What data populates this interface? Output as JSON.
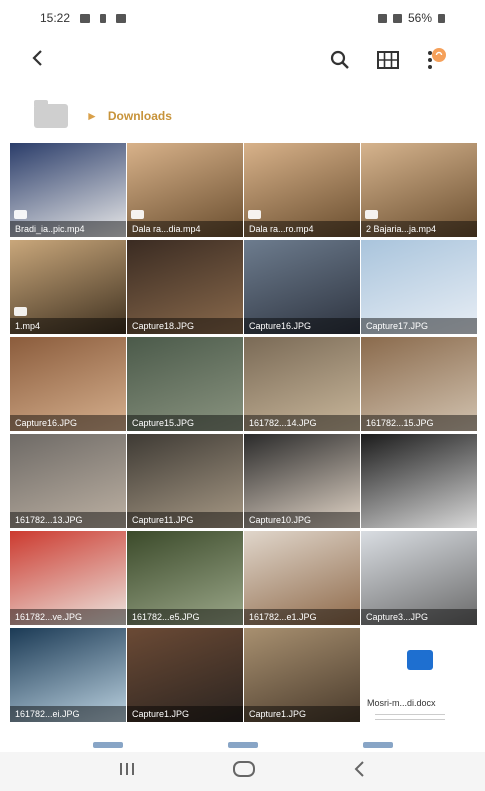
{
  "status": {
    "time": "15:22",
    "battery": "56%"
  },
  "appbar": {
    "back_icon": "back-arrow-icon",
    "search_icon": "search-icon",
    "grid_icon": "grid-view-icon",
    "menu_icon": "more-options-icon",
    "accent": "#f5a05a"
  },
  "path": {
    "label": "Downloads"
  },
  "tiles": [
    {
      "name": "Bradi_ia..pic.mp4",
      "colors": [
        "#2b3d6a",
        "#e9e9e9"
      ],
      "video": true
    },
    {
      "name": "Dala ra...dia.mp4",
      "colors": [
        "#d8b28a",
        "#6a4e2f"
      ],
      "video": true
    },
    {
      "name": "Dala ra...ro.mp4",
      "colors": [
        "#d8b28a",
        "#6a4e2f"
      ],
      "video": true
    },
    {
      "name": "2 Bajaria...ja.mp4",
      "colors": [
        "#d6b48e",
        "#6a4e2f"
      ],
      "video": true
    },
    {
      "name": "1.mp4",
      "colors": [
        "#c9a77b",
        "#3f3120"
      ],
      "video": true
    },
    {
      "name": "Capture18.JPG",
      "colors": [
        "#3a2b22",
        "#8a6a4c"
      ],
      "video": false
    },
    {
      "name": "Capture16.JPG",
      "colors": [
        "#6d7c8e",
        "#2e3440"
      ],
      "video": false
    },
    {
      "name": "Capture17.JPG",
      "colors": [
        "#a9c4dc",
        "#e8eef5"
      ],
      "video": false
    },
    {
      "name": "Capture16.JPG",
      "colors": [
        "#8b5c3c",
        "#d6b08e"
      ],
      "video": false
    },
    {
      "name": "Capture15.JPG",
      "colors": [
        "#4b5a4a",
        "#8a9480"
      ],
      "video": false
    },
    {
      "name": "161782...14.JPG",
      "colors": [
        "#7a6a56",
        "#c9b79b"
      ],
      "video": false
    },
    {
      "name": "161782...15.JPG",
      "colors": [
        "#8a6a4c",
        "#d2c3b0"
      ],
      "video": false
    },
    {
      "name": "161782...13.JPG",
      "colors": [
        "#6e6a66",
        "#bdb1a3"
      ],
      "video": false
    },
    {
      "name": "Capture11.JPG",
      "colors": [
        "#3e3a34",
        "#a89a86"
      ],
      "video": false
    },
    {
      "name": "Capture10.JPG",
      "colors": [
        "#2a2a2a",
        "#e3d6c8"
      ],
      "video": false
    },
    {
      "name": "",
      "colors": [
        "#1b1b1b",
        "#d9d9d9"
      ],
      "video": false
    },
    {
      "name": "161782...ve.JPG",
      "colors": [
        "#cc3a2f",
        "#ece7e1"
      ],
      "video": false
    },
    {
      "name": "161782...e5.JPG",
      "colors": [
        "#3b4a2a",
        "#9ca88a"
      ],
      "video": false
    },
    {
      "name": "161782...e1.JPG",
      "colors": [
        "#e0d6cb",
        "#8f6a4a"
      ],
      "video": false
    },
    {
      "name": "Capture3...JPG",
      "colors": [
        "#d9dde2",
        "#6a6a6a"
      ],
      "video": false
    },
    {
      "name": "161782...ei.JPG",
      "colors": [
        "#1b3a55",
        "#bcd2e0"
      ],
      "video": false
    },
    {
      "name": "Capture1.JPG",
      "colors": [
        "#6b4a35",
        "#2b2420"
      ],
      "video": false
    },
    {
      "name": "Capture1.JPG",
      "colors": [
        "#a89070",
        "#4a3b2c"
      ],
      "video": false
    },
    {
      "doc": true,
      "name": "Mosri-m...di.docx"
    }
  ],
  "nav": {
    "recent_icon": "recent-apps-icon",
    "home_icon": "home-icon",
    "back_icon": "nav-back-icon"
  }
}
